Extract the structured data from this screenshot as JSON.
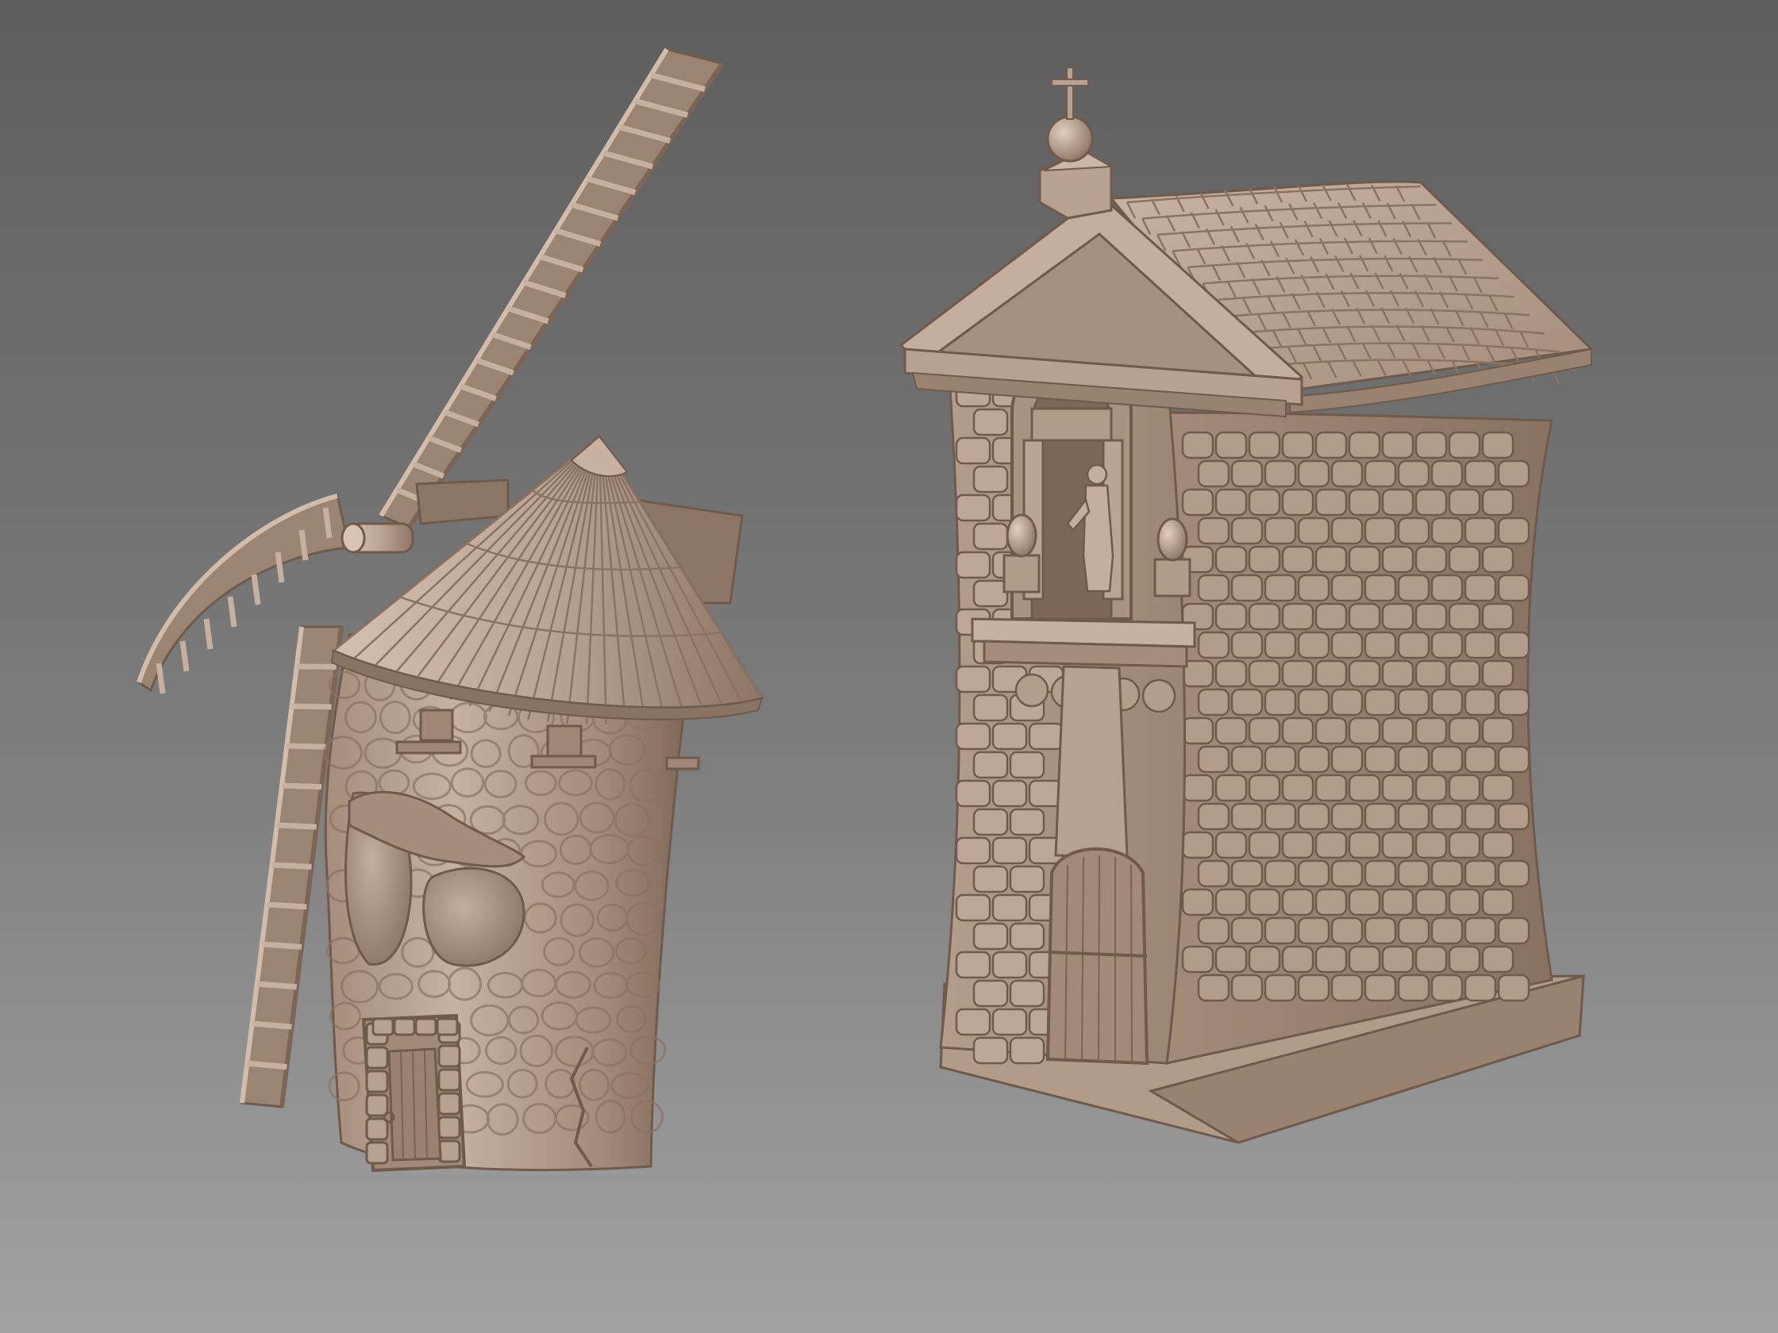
{
  "scene": {
    "background": {
      "top": "#5e5e5e",
      "mid": "#7c7c7c",
      "bottom": "#a2a2a2"
    },
    "clay": {
      "light": "#d8c2b3",
      "base": "#b19a89",
      "mid": "#98806f",
      "dark": "#6f5a4c",
      "deep": "#4f3f35"
    },
    "models": [
      {
        "name": "windmill",
        "parts": [
          "sails",
          "conical-roof",
          "stone-tower",
          "window-eyes",
          "wooden-door"
        ]
      },
      {
        "name": "stone-chapel",
        "parts": [
          "cross-finial",
          "tiled-roof",
          "pediment",
          "statue-niche",
          "brick-walls",
          "arched-door",
          "plinth-base"
        ]
      }
    ]
  }
}
